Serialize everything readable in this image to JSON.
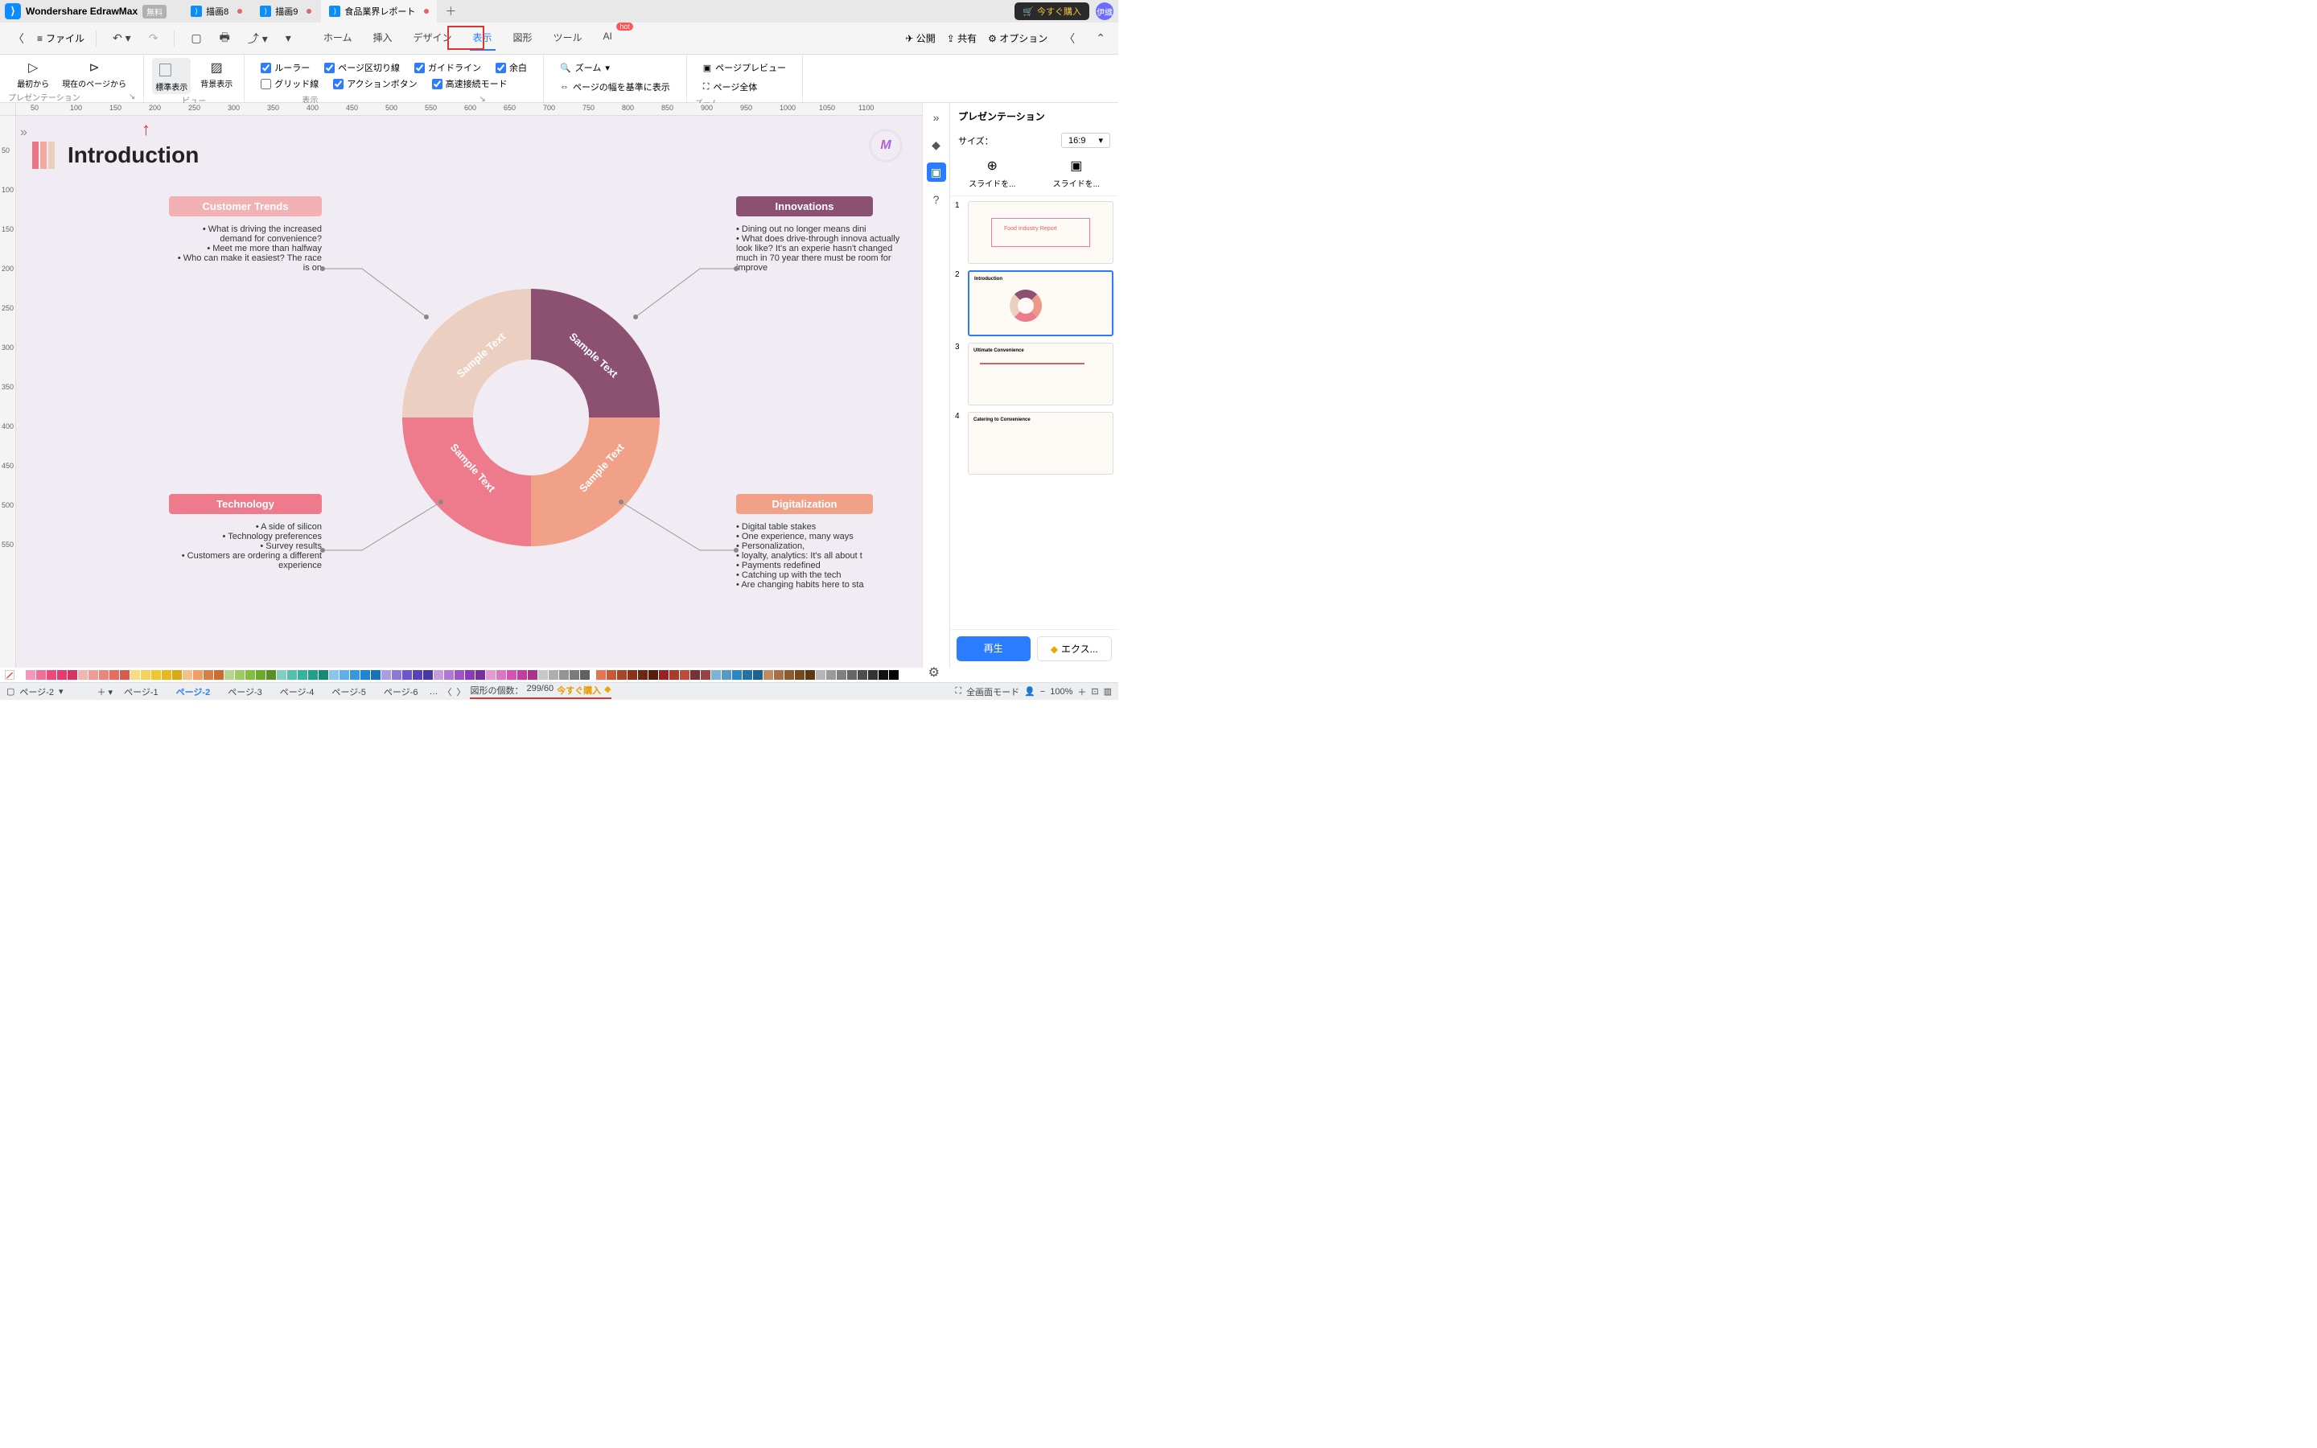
{
  "app": {
    "name": "Wondershare EdrawMax",
    "free_label": "無料"
  },
  "tabs": [
    {
      "label": "描画8",
      "dirty": true
    },
    {
      "label": "描画9",
      "dirty": true
    },
    {
      "label": "食品業界レポート",
      "dirty": true,
      "active": true
    }
  ],
  "titlebar": {
    "buy": "今すぐ購入",
    "avatar": "伊織"
  },
  "menutabs": [
    "ホーム",
    "挿入",
    "デザイン",
    "表示",
    "図形",
    "ツール",
    "AI"
  ],
  "menutab_active": 3,
  "file_label": "ファイル",
  "ai_hot": "hot",
  "right_actions": {
    "publish": "公開",
    "share": "共有",
    "options": "オプション"
  },
  "ribbon": {
    "presentation": {
      "from_start": "最初から",
      "from_current": "現在のページから",
      "group": "プレゼンテーション"
    },
    "view": {
      "standard": "標準表示",
      "background": "背景表示",
      "group": "ビュー"
    },
    "display": {
      "ruler": "ルーラー",
      "pagebreak": "ページ区切り線",
      "guideline": "ガイドライン",
      "margin": "余白",
      "grid": "グリッド線",
      "action": "アクションボタン",
      "fast": "高速接続モード",
      "group": "表示",
      "checked": {
        "ruler": true,
        "pagebreak": true,
        "guideline": true,
        "margin": true,
        "grid": false,
        "action": true,
        "fast": true
      }
    },
    "zoom": {
      "zoom": "ズーム",
      "fitwidth": "ページの幅を基準に表示",
      "preview": "ページプレビュー",
      "pagefull": "ページ全体",
      "group": "ズーム"
    }
  },
  "canvas": {
    "title": "Introduction",
    "logo": "M",
    "blocks": {
      "customer": {
        "header": "Customer Trends",
        "color": "#f1b1b5",
        "bullets": [
          "What is driving the increased demand for convenience?",
          "Meet me more than halfway",
          "Who can make it easiest? The race is on"
        ]
      },
      "innov": {
        "header": "Innovations",
        "color": "#8c5070",
        "bullets": [
          "Dining out no longer means dini",
          "What does drive-through innova actually look like? It's an experie hasn't changed much in 70 year there must be room for improve"
        ]
      },
      "tech": {
        "header": "Technology",
        "color": "#ee7b8c",
        "bullets": [
          "A side of silicon",
          "Technology preferences",
          "Survey results",
          "Customers are ordering a different experience"
        ]
      },
      "digital": {
        "header": "Digitalization",
        "color": "#f2a189",
        "bullets": [
          "Digital table stakes",
          "One experience, many ways",
          "Personalization,",
          "loyalty, analytics: It's all about t",
          "Payments redefined",
          "Catching up with the tech",
          "Are changing habits here to sta"
        ]
      }
    },
    "segment": "Sample Text"
  },
  "panel": {
    "title": "プレゼンテーション",
    "size_label": "サイズ：",
    "size_value": "16:9",
    "create_slides": "スライドを...",
    "create_slides2": "スライドを...",
    "play": "再生",
    "export": "エクス...",
    "thumbs": [
      {
        "t": "Food Industry Report"
      },
      {
        "t": "Introduction"
      },
      {
        "t": "Ultimate Convenience"
      },
      {
        "t": "Catering to Convenience"
      }
    ]
  },
  "colors": [
    "#fff",
    "#f598b8",
    "#f16e98",
    "#ec4b7a",
    "#e83b6c",
    "#d63363",
    "#f2b6b0",
    "#ef9d94",
    "#ec857a",
    "#e76b5e",
    "#d95b4e",
    "#f6dd82",
    "#f3d25c",
    "#efc634",
    "#e9b81a",
    "#d7a915",
    "#f2c189",
    "#ef9e65",
    "#d78046",
    "#cc6c32",
    "#b7d58e",
    "#9ccb65",
    "#7fbe3f",
    "#68a92e",
    "#579122",
    "#82cfc1",
    "#55bfab",
    "#36b39c",
    "#1ea188",
    "#168a74",
    "#8ac5f0",
    "#5eafea",
    "#3498e3",
    "#1f86d6",
    "#1672bc",
    "#a99de3",
    "#8a79d9",
    "#6c56ce",
    "#5842b9",
    "#4a37a0",
    "#c59bdd",
    "#b277d2",
    "#9e54c7",
    "#8a3cb6",
    "#76309e",
    "#e49ad0",
    "#dc76c1",
    "#d352b2",
    "#c33ca0",
    "#ab318b",
    "#c7c7c7",
    "#aeaeae",
    "#949494",
    "#7b7b7b",
    "#616161"
  ],
  "colors2": [
    "#e47752",
    "#c75939",
    "#a84527",
    "#8b3319",
    "#6f250f",
    "#5a1c0a",
    "#922",
    "#aa3a2a",
    "#c14b36",
    "#733",
    "#944",
    "#7fb3d5",
    "#5499c7",
    "#2e86c1",
    "#2471a3",
    "#1f618d",
    "#be8c63",
    "#a77044",
    "#8e5b2e",
    "#76481f",
    "#5e3813",
    "#b5b5b5",
    "#9a9a9a",
    "#808080",
    "#666",
    "#4d4d4d",
    "#333",
    "#111",
    "#000"
  ],
  "status": {
    "page_label": "ページ-2",
    "pages": [
      "ページ-1",
      "ページ-2",
      "ページ-3",
      "ページ-4",
      "ページ-5",
      "ページ-6"
    ],
    "active_page": 1,
    "shape_count_label": "図形の個数：",
    "shape_count": "299/60",
    "buy_now": "今すぐ購入",
    "fullscreen": "全画面モード",
    "zoom": "100%"
  },
  "ruler_h": [
    50,
    100,
    150,
    200,
    250,
    300,
    350,
    400,
    450,
    500,
    550,
    600,
    650,
    700,
    750,
    800,
    850,
    900,
    950,
    1000,
    1050,
    1100
  ],
  "ruler_v": [
    50,
    100,
    150,
    200,
    250,
    300,
    350,
    400,
    450,
    500,
    550
  ]
}
